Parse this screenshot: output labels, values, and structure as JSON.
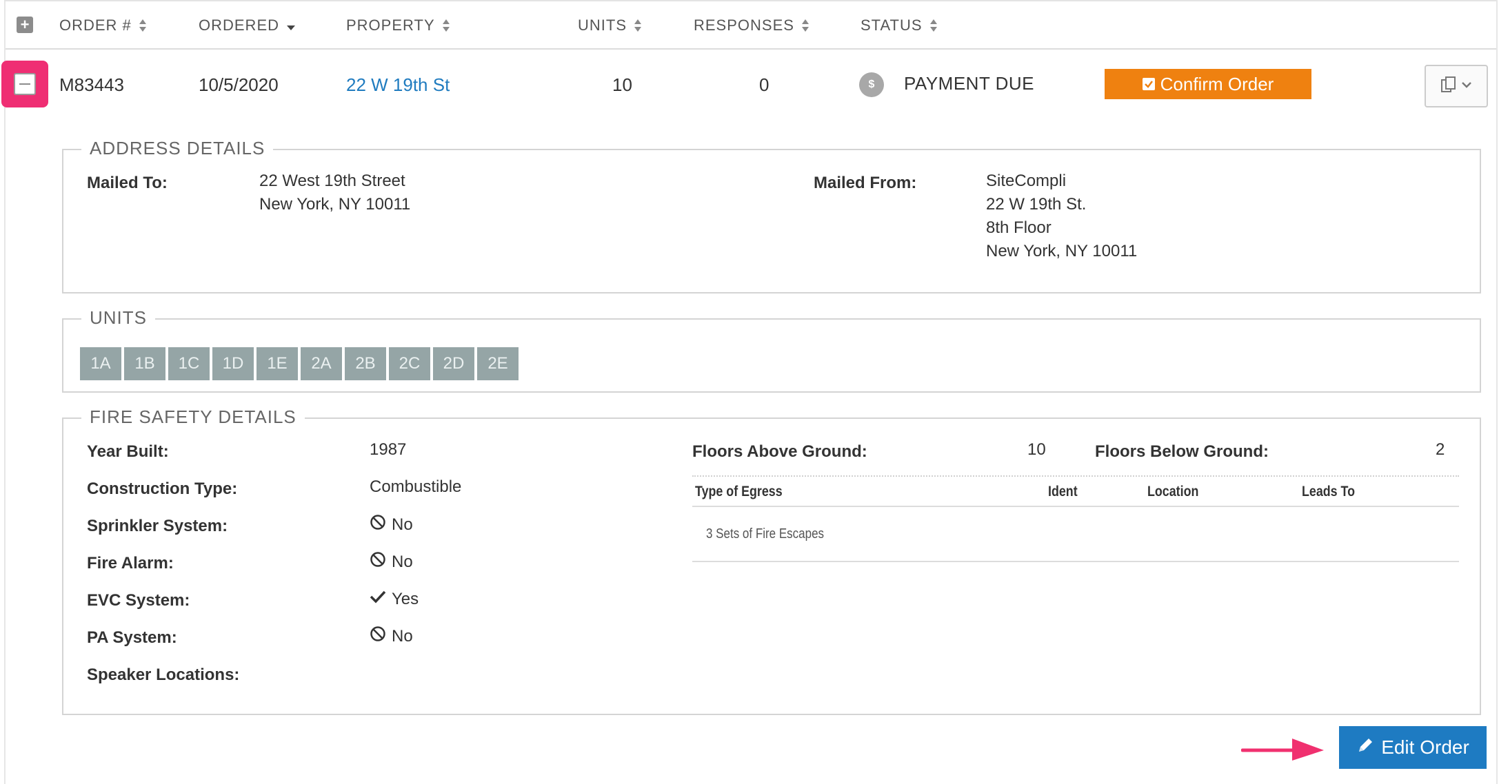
{
  "header": {
    "columns": [
      {
        "label": "ORDER #"
      },
      {
        "label": "ORDERED"
      },
      {
        "label": "PROPERTY"
      },
      {
        "label": "UNITS"
      },
      {
        "label": "RESPONSES"
      },
      {
        "label": "STATUS"
      }
    ]
  },
  "order": {
    "number": "M83443",
    "ordered": "10/5/2020",
    "property": "22 W 19th St",
    "units": "10",
    "responses": "0",
    "status": "PAYMENT DUE",
    "status_icon_glyph": "$",
    "confirm_label": "Confirm Order"
  },
  "address": {
    "legend": "ADDRESS DETAILS",
    "mailed_to_label": "Mailed To:",
    "mailed_to": [
      "22 West 19th Street",
      "New York, NY 10011"
    ],
    "mailed_from_label": "Mailed From:",
    "mailed_from": [
      "SiteCompli",
      "22 W 19th St.",
      "8th Floor",
      "New York, NY 10011"
    ]
  },
  "units": {
    "legend": "UNITS",
    "items": [
      "1A",
      "1B",
      "1C",
      "1D",
      "1E",
      "2A",
      "2B",
      "2C",
      "2D",
      "2E"
    ]
  },
  "fire_safety": {
    "legend": "FIRE SAFETY DETAILS",
    "year_built_label": "Year Built:",
    "year_built": "1987",
    "construction_label": "Construction Type:",
    "construction": "Combustible",
    "sprinkler_label": "Sprinkler System:",
    "sprinkler": "No",
    "fire_alarm_label": "Fire Alarm:",
    "fire_alarm": "No",
    "evc_label": "EVC System:",
    "evc": "Yes",
    "pa_label": "PA System:",
    "pa": "No",
    "speaker_label": "Speaker Locations:",
    "floors_above_label": "Floors Above Ground:",
    "floors_above": "10",
    "floors_below_label": "Floors Below Ground:",
    "floors_below": "2",
    "egress_headers": [
      "Type of Egress",
      "Ident",
      "Location",
      "Leads To"
    ],
    "egress_rows": [
      [
        "3 Sets of Fire Escapes"
      ]
    ]
  },
  "footer": {
    "edit_label": "Edit Order"
  },
  "colors": {
    "accent_orange": "#ef8110",
    "accent_blue": "#1e7bc2",
    "highlight_pink": "#ef2e73",
    "unit_chip": "#95a5a6"
  },
  "icons": [
    "plus-square-icon",
    "minus-square-icon",
    "sort-icon",
    "sort-desc-icon",
    "dollar-icon",
    "checkbox-icon",
    "copy-icon",
    "chevron-down-icon",
    "ban-icon",
    "check-icon",
    "pencil-icon",
    "arrow-right-icon"
  ]
}
